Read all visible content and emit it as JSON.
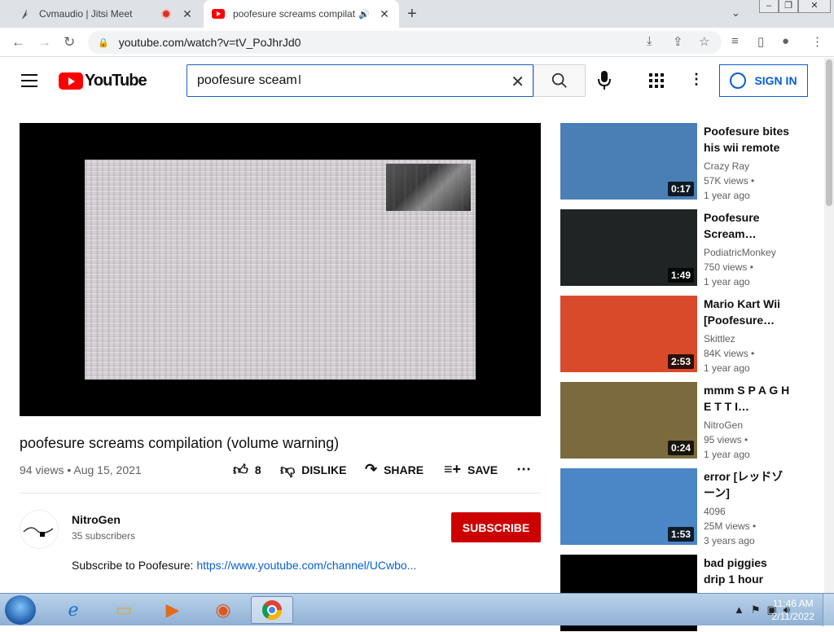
{
  "browser": {
    "tabs": [
      {
        "title": "Cvmaudio | Jitsi Meet",
        "close": "✕"
      },
      {
        "title": "poofesure screams compilat",
        "close": "✕"
      }
    ],
    "new_tab": "+",
    "url": "youtube.com/watch?v=tV_PoJhrJd0"
  },
  "youtube": {
    "logo_text": "YouTube",
    "search_value": "poofesure sceam",
    "sign_in": "SIGN IN"
  },
  "video": {
    "title": "poofesure screams compilation (volume warning)",
    "meta": "94 views • Aug 15, 2021",
    "likes": "8",
    "dislike": "DISLIKE",
    "share": "SHARE",
    "save": "SAVE",
    "channel": "NitroGen",
    "subscribers": "35 subscribers",
    "subscribe": "SUBSCRIBE",
    "desc_prefix": "Subscribe to Poofesure: ",
    "desc_link": "https://www.youtube.com/channel/UCwbo..."
  },
  "recommendations": [
    {
      "title": "Poofesure bites his wii remote",
      "channel": "Crazy Ray",
      "views": "57K views •",
      "ago": "1 year ago",
      "duration": "0:17",
      "color": "#4a7fb5"
    },
    {
      "title": "Poofesure Scream…",
      "channel": "PodiatricMonkey",
      "views": "750 views •",
      "ago": "1 year ago",
      "duration": "1:49",
      "color": "#202424"
    },
    {
      "title": "Mario Kart Wii [Poofesure…",
      "channel": "Skittlez",
      "views": "84K views •",
      "ago": "1 year ago",
      "duration": "2:53",
      "color": "#d94a2a"
    },
    {
      "title": "mmm S P A G H E T T I…",
      "channel": "NitroGen",
      "views": "95 views •",
      "ago": "1 year ago",
      "duration": "0:24",
      "color": "#7a6a3e"
    },
    {
      "title": "error [レッドゾーン]",
      "channel": "4096",
      "views": "25M views •",
      "ago": "3 years ago",
      "duration": "1:53",
      "color": "#4b86c6"
    },
    {
      "title": "bad piggies drip 1 hour",
      "channel": "",
      "views": "",
      "ago": "",
      "duration": "",
      "color": "#000000"
    }
  ],
  "taskbar": {
    "time": "11:46 AM",
    "date": "2/11/2022"
  }
}
